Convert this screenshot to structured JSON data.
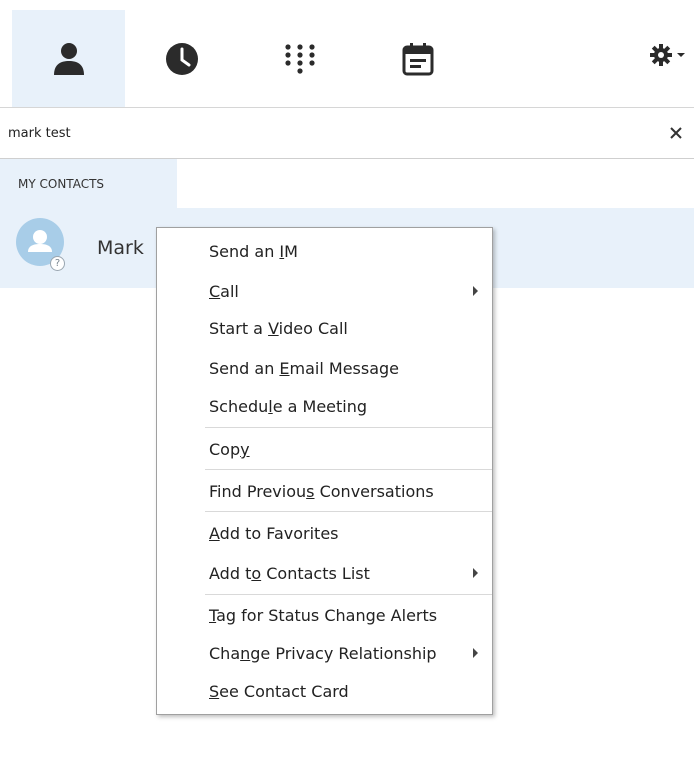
{
  "nav": {
    "tabs": [
      {
        "name": "contacts",
        "icon": "person-icon",
        "active": true
      },
      {
        "name": "history",
        "icon": "clock-icon",
        "active": false
      },
      {
        "name": "dialpad",
        "icon": "dialpad-icon",
        "active": false
      },
      {
        "name": "meetings",
        "icon": "calendar-icon",
        "active": false
      }
    ],
    "options_icon": "gear-icon"
  },
  "search": {
    "value": "mark test",
    "clear_icon": "close-icon"
  },
  "groups": {
    "active_label": "MY CONTACTS"
  },
  "contact": {
    "name": "Mark",
    "presence_glyph": "?",
    "avatar_color": "#a8cde8"
  },
  "context_menu": {
    "items": [
      {
        "pre": "Send an ",
        "key": "I",
        "post": "M",
        "submenu": false
      },
      {
        "pre": "",
        "key": "C",
        "post": "all",
        "submenu": true
      },
      {
        "pre": "Start a ",
        "key": "V",
        "post": "ideo Call",
        "submenu": false
      },
      {
        "pre": "Send an ",
        "key": "E",
        "post": "mail Message",
        "submenu": false
      },
      {
        "pre": "Schedu",
        "key": "l",
        "post": "e a Meeting",
        "submenu": false
      },
      {
        "pre": "Cop",
        "key": "y",
        "post": "",
        "submenu": false
      },
      {
        "pre": "Find Previou",
        "key": "s",
        "post": " Conversations",
        "submenu": false
      },
      {
        "pre": "",
        "key": "A",
        "post": "dd to Favorites",
        "submenu": false
      },
      {
        "pre": "Add t",
        "key": "o",
        "post": " Contacts List",
        "submenu": true
      },
      {
        "pre": "",
        "key": "T",
        "post": "ag for Status Change Alerts",
        "submenu": false
      },
      {
        "pre": "Cha",
        "key": "n",
        "post": "ge Privacy Relationship",
        "submenu": true
      },
      {
        "pre": "",
        "key": "S",
        "post": "ee Contact Card",
        "submenu": false
      }
    ]
  },
  "colors": {
    "accent_bg": "#e8f1fa",
    "icon_dark": "#2b2b2b"
  }
}
